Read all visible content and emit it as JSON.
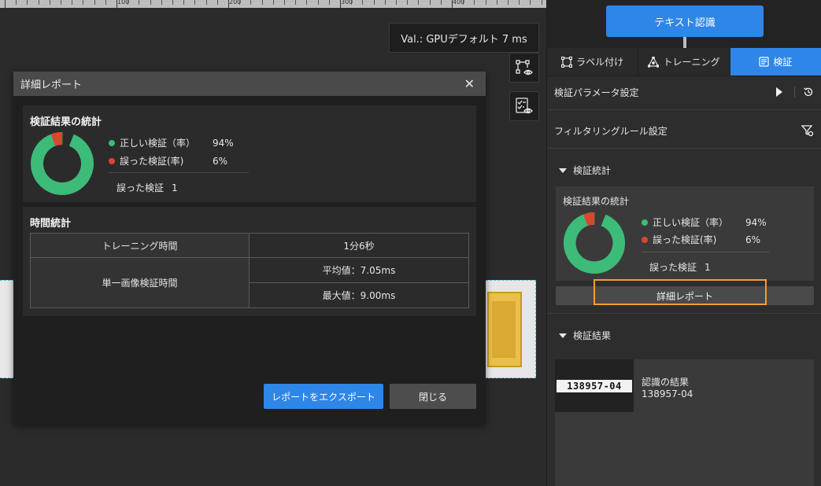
{
  "ruler": {
    "labels": [
      "100",
      "200",
      "300",
      "400"
    ]
  },
  "canvas": {
    "val_text": "Val.: GPUデフォルト 7 ms"
  },
  "dialog": {
    "title": "詳細レポート",
    "close_glyph": "✕",
    "stats": {
      "title": "検証結果の統計",
      "correct_label": "正しい検証（率）",
      "correct_value": "94%",
      "wrong_label": "誤った検証(率)",
      "wrong_value": "6%",
      "wrong_count_label": "誤った検証",
      "wrong_count": "1"
    },
    "time": {
      "title": "時間統計",
      "training_label": "トレーニング時間",
      "training_value": "1分6秒",
      "single_label": "単一画像検証時間",
      "avg": "平均値：7.05ms",
      "max": "最大値：9.00ms"
    },
    "export_label": "レポートをエクスポート",
    "close_label": "閉じる"
  },
  "panel": {
    "recognize_label": "テキスト認識",
    "tabs": [
      {
        "label": "ラベル付け",
        "icon": "label-icon",
        "active": false
      },
      {
        "label": "トレーニング",
        "icon": "training-icon",
        "active": false
      },
      {
        "label": "検証",
        "icon": "validate-icon",
        "active": true
      }
    ],
    "param_label": "検証パラメータ設定",
    "filter_label": "フィルタリングルール設定",
    "stats_section": "検証統計",
    "stats": {
      "title": "検証結果の統計",
      "correct_label": "正しい検証（率）",
      "correct_value": "94%",
      "wrong_label": "誤った検証(率)",
      "wrong_value": "6%",
      "wrong_count_label": "誤った検証",
      "wrong_count": "1"
    },
    "detail_label": "詳細レポート",
    "results_section": "検証結果",
    "result": {
      "plate_text": "138957-04",
      "label": "認識の結果",
      "value": "138957-04"
    }
  },
  "chart_data": [
    {
      "type": "pie",
      "categories": [
        "正しい検証（率）",
        "誤った検証(率)"
      ],
      "values": [
        94,
        6
      ],
      "colors": [
        "#3dbb78",
        "#d9472f"
      ]
    },
    {
      "type": "pie",
      "categories": [
        "正しい検証（率）",
        "誤った検証(率)"
      ],
      "values": [
        94,
        6
      ],
      "colors": [
        "#3dbb78",
        "#d9472f"
      ]
    }
  ],
  "colors": {
    "accent": "#2e86e8",
    "correct": "#3dbb78",
    "wrong": "#d9472f",
    "highlight": "#f0a030"
  }
}
